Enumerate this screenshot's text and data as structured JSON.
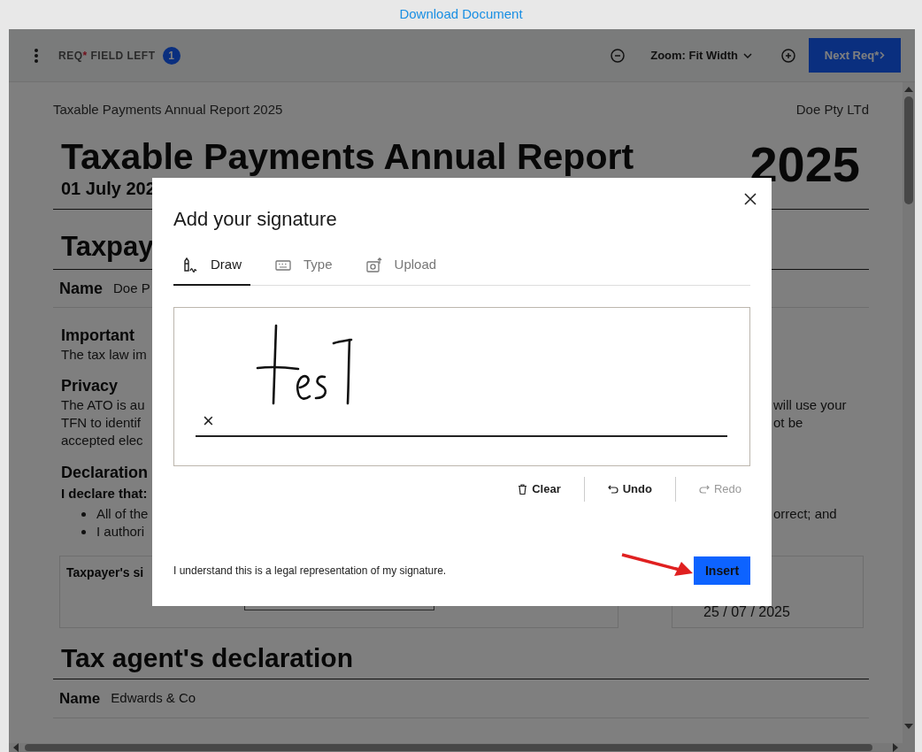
{
  "top_bar": {
    "link": "Download Document"
  },
  "toolbar": {
    "required_label": "REQ",
    "required_mark": "*",
    "required_suffix": "FIELD LEFT",
    "count": "1",
    "zoom": "Zoom: Fit Width",
    "next_button": "Next Req*"
  },
  "document": {
    "header_left": "Taxable Payments Annual Report 2025",
    "header_right": "Doe Pty LTd",
    "title": "Taxable Payments Annual Report",
    "year": "2025",
    "period": "01 July 202",
    "section_heading": "Taxpay",
    "name_label": "Name",
    "name_value": "Doe P",
    "important_heading": "Important",
    "important_text": "The tax law im",
    "privacy_heading": "Privacy",
    "privacy_lines": [
      {
        "left": "The ATO is au",
        "right": "will use your"
      },
      {
        "left": "TFN to identif",
        "right": "ot be"
      },
      {
        "left": "accepted elec"
      }
    ],
    "declaration_heading": "Declaration",
    "declare_intro": "I declare that:",
    "bullets": [
      {
        "left": "All of the",
        "right": "orrect; and"
      },
      {
        "left": "I authori"
      }
    ],
    "signature_label": "Taxpayer's si",
    "date_value": "25 / 07 / 2025",
    "agent_heading": "Tax agent's declaration",
    "agent_name_label": "Name",
    "agent_name_value": "Edwards & Co"
  },
  "dialog": {
    "title": "Add your signature",
    "tabs": [
      {
        "kind": "draw",
        "label": "Draw",
        "selected": true
      },
      {
        "kind": "type",
        "label": "Type",
        "selected": false
      },
      {
        "kind": "upload",
        "label": "Upload",
        "selected": false
      }
    ],
    "sign_mark": "×",
    "actions": [
      {
        "kind": "clear",
        "label": "Clear",
        "disabled": false
      },
      {
        "kind": "undo",
        "label": "Undo",
        "disabled": false
      },
      {
        "kind": "redo",
        "label": "Redo",
        "disabled": true
      }
    ],
    "notice": "I understand this is a legal representation of my signature.",
    "insert_button": "Insert"
  }
}
